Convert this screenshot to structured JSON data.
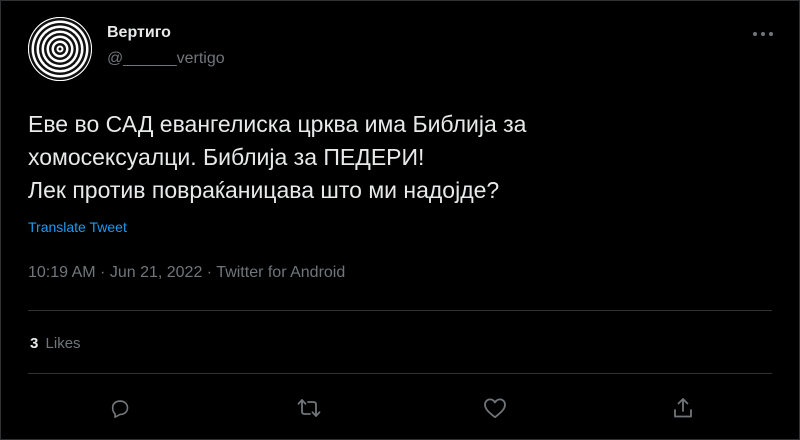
{
  "author": {
    "display_name": "Вертиго",
    "handle": "@______vertigo"
  },
  "tweet": {
    "lines": [
      "Еве во САД евангелиска црква има Библија за",
      "хомосексуалци. Библија за ПЕДЕРИ!",
      "Лек против повраќаницава што ми надојде?"
    ],
    "translate_label": "Translate Tweet",
    "time": "10:19 AM",
    "date": "Jun 21, 2022",
    "source": "Twitter for Android",
    "separator": " · "
  },
  "stats": {
    "likes_count": "3",
    "likes_label": "Likes"
  },
  "icons": {
    "more": "more-options-icon",
    "reply": "reply-icon",
    "retweet": "retweet-icon",
    "like": "like-icon",
    "share": "share-icon"
  },
  "colors": {
    "background": "#000000",
    "text": "#e7e9ea",
    "secondary": "#71767b",
    "link": "#1d9bf0",
    "divider": "#2f3336"
  }
}
